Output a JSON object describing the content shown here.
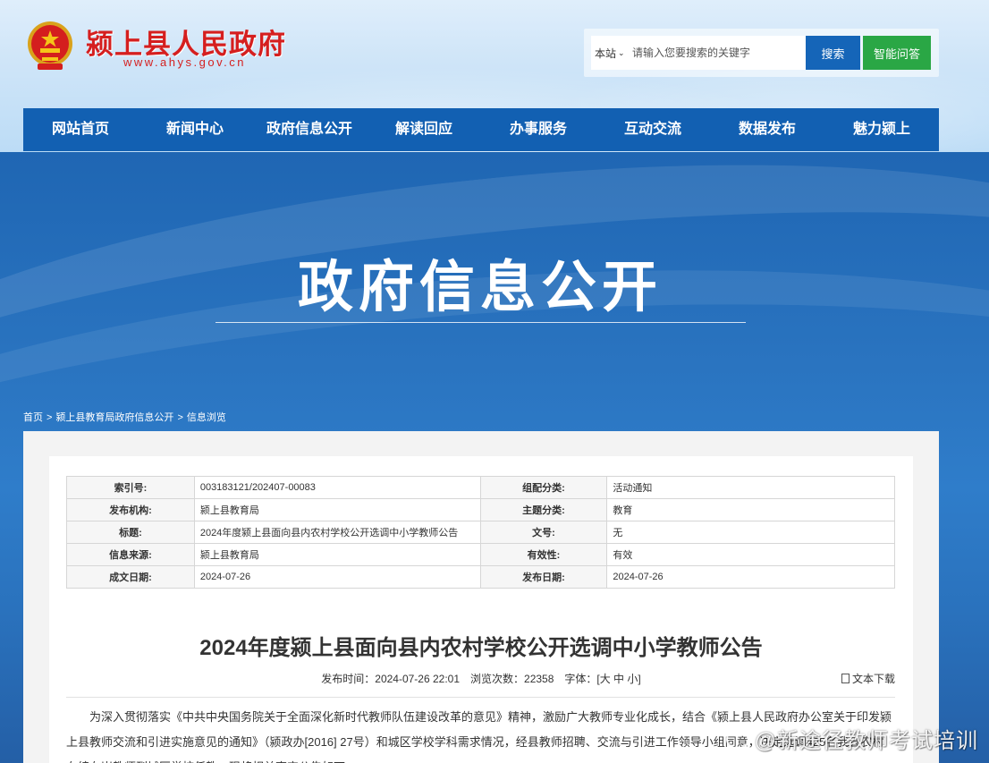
{
  "header": {
    "site_name": "颍上县人民政府",
    "site_url": "www.ahys.gov.cn",
    "search": {
      "scope": "本站",
      "placeholder": "请输入您要搜索的关键字",
      "search_label": "搜索",
      "ai_label": "智能问答"
    }
  },
  "nav": [
    {
      "label": "网站首页"
    },
    {
      "label": "新闻中心"
    },
    {
      "label": "政府信息公开"
    },
    {
      "label": "解读回应"
    },
    {
      "label": "办事服务"
    },
    {
      "label": "互动交流"
    },
    {
      "label": "数据发布"
    },
    {
      "label": "魅力颍上"
    }
  ],
  "banner": {
    "title": "政府信息公开"
  },
  "breadcrumb": [
    "首页",
    "颍上县教育局政府信息公开",
    "信息浏览"
  ],
  "meta_table": [
    {
      "k1": "索引号:",
      "v1": "003183121/202407-00083",
      "k2": "组配分类:",
      "v2": "活动通知"
    },
    {
      "k1": "发布机构:",
      "v1": "颍上县教育局",
      "k2": "主题分类:",
      "v2": "教育"
    },
    {
      "k1": "标题:",
      "v1": "2024年度颍上县面向县内农村学校公开选调中小学教师公告",
      "k2": "文号:",
      "v2": "无"
    },
    {
      "k1": "信息来源:",
      "v1": "颍上县教育局",
      "k2": "有效性:",
      "v2": "有效"
    },
    {
      "k1": "成文日期:",
      "v1": "2024-07-26",
      "k2": "发布日期:",
      "v2": "2024-07-26"
    }
  ],
  "article": {
    "title": "2024年度颍上县面向县内农村学校公开选调中小学教师公告",
    "publish_time": "发布时间：2024-07-26 22:01",
    "views": "浏览次数：22358",
    "font_size": "字体：[大 中 小]",
    "download": "文本下载",
    "body": "为深入贯彻落实《中共中央国务院关于全面深化新时代教师队伍建设改革的意见》精神，激励广大教师专业化成长，结合《颍上县人民政府办公室关于印发颍上县教师交流和引进实施意见的通知》（颍政办[2016] 27号）和城区学校学科需求情况，经县教师招聘、交流与引进工作领导小组同意，决定选调425名我县农村在编在岗教师到城区学校任教，现将相关事宜公告如下。"
  },
  "watermark": "@新途径教师考试培训"
}
